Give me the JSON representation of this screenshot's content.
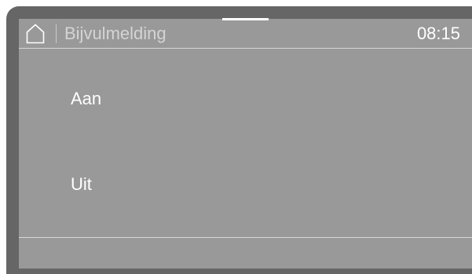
{
  "header": {
    "home_icon": "house-outline-icon",
    "title": "Bijvulmelding",
    "clock": "08:15"
  },
  "options": [
    {
      "label": "Aan"
    },
    {
      "label": "Uit"
    }
  ],
  "colors": {
    "frame": "#666666",
    "screen": "#999999",
    "text": "#ffffff",
    "title_text": "#d4d4d4"
  }
}
